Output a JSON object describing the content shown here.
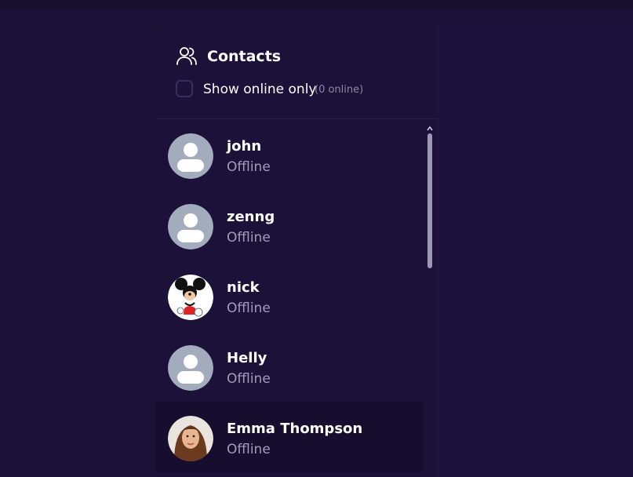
{
  "header": {
    "title": "Contacts",
    "icon": "users-icon",
    "filter_label": "Show online only",
    "online_count": "(0 online)",
    "filter_checked": false
  },
  "contacts": [
    {
      "name": "john",
      "status": "Offline",
      "avatar": "default-avatar",
      "selected": false
    },
    {
      "name": "zenng",
      "status": "Offline",
      "avatar": "default-avatar",
      "selected": false
    },
    {
      "name": "nick",
      "status": "Offline",
      "avatar": "mickey-mouse-photo",
      "selected": false
    },
    {
      "name": "Helly",
      "status": "Offline",
      "avatar": "default-avatar",
      "selected": false
    },
    {
      "name": "Emma Thompson",
      "status": "Offline",
      "avatar": "woman-photo",
      "selected": true
    }
  ],
  "colors": {
    "background": "#1c1238",
    "sidebar": "#1c1138",
    "selected_row": "#170d2e",
    "text_primary": "#ffffff",
    "text_secondary": "#a49cbc",
    "avatar_placeholder": "#a3acbd"
  },
  "scrollbar": {
    "icon": "chevron-up-icon"
  }
}
